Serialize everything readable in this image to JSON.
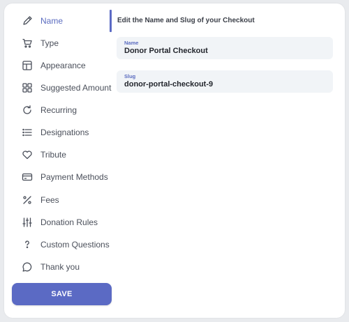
{
  "sidebar": {
    "items": [
      {
        "label": "Name",
        "icon": "pencil-icon"
      },
      {
        "label": "Type",
        "icon": "cart-icon"
      },
      {
        "label": "Appearance",
        "icon": "layout-icon"
      },
      {
        "label": "Suggested Amount",
        "icon": "grid-icon"
      },
      {
        "label": "Recurring",
        "icon": "refresh-icon"
      },
      {
        "label": "Designations",
        "icon": "list-icon"
      },
      {
        "label": "Tribute",
        "icon": "heart-icon"
      },
      {
        "label": "Payment Methods",
        "icon": "credit-card-icon"
      },
      {
        "label": "Fees",
        "icon": "percent-icon"
      },
      {
        "label": "Donation Rules",
        "icon": "sliders-icon"
      },
      {
        "label": "Custom Questions",
        "icon": "question-icon"
      },
      {
        "label": "Thank you",
        "icon": "chat-icon"
      }
    ],
    "active_index": 0,
    "save_label": "SAVE"
  },
  "main": {
    "heading": "Edit the Name and Slug of your Checkout",
    "name_field": {
      "label": "Name",
      "value": "Donor Portal Checkout"
    },
    "slug_field": {
      "label": "Slug",
      "value": "donor-portal-checkout-9"
    }
  },
  "colors": {
    "accent": "#5b6ac4",
    "field_bg": "#f1f4f7",
    "text": "#4a4f5a"
  }
}
